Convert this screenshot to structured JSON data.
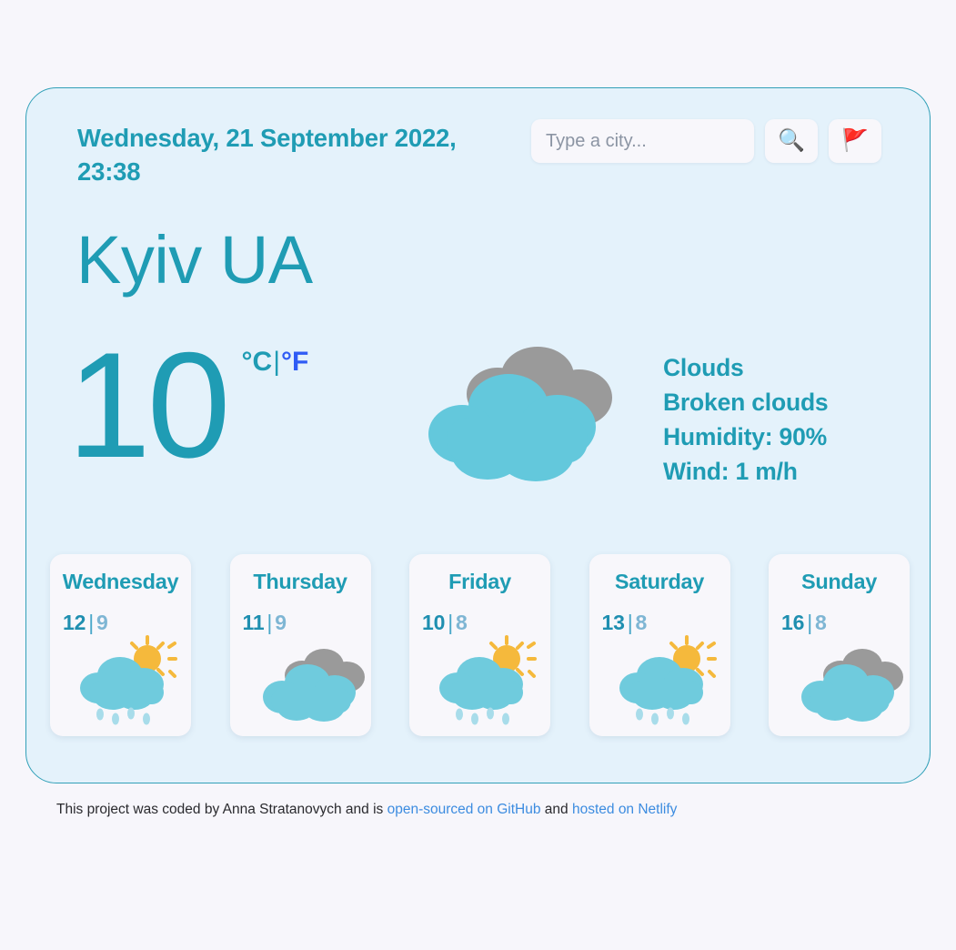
{
  "header": {
    "current_date": "Wednesday, 21 September 2022, 23:38",
    "search": {
      "placeholder": "Type a city...",
      "value": "",
      "search_button_icon": "magnifying-glass-icon",
      "search_button_glyph": "🔍",
      "location_button_icon": "flag-icon",
      "location_button_glyph": "🚩"
    }
  },
  "current": {
    "city": "Kyiv UA",
    "temperature": "10",
    "unit_celsius": "°C",
    "unit_separator": "|",
    "unit_fahrenheit": "°F",
    "active_unit": "°C",
    "icon": "broken-clouds-icon",
    "details": {
      "main": "Clouds",
      "description": "Broken clouds",
      "humidity": "Humidity: 90%",
      "wind": "Wind: 1 m/h"
    }
  },
  "forecast": [
    {
      "day": "Wednesday",
      "max": "12",
      "sep": "|",
      "min": "9",
      "icon": "sun-rain-cloud-icon"
    },
    {
      "day": "Thursday",
      "max": "11",
      "sep": "|",
      "min": "9",
      "icon": "broken-clouds-icon"
    },
    {
      "day": "Friday",
      "max": "10",
      "sep": "|",
      "min": "8",
      "icon": "sun-rain-cloud-icon"
    },
    {
      "day": "Saturday",
      "max": "13",
      "sep": "|",
      "min": "8",
      "icon": "sun-rain-cloud-icon"
    },
    {
      "day": "Sunday",
      "max": "16",
      "sep": "|",
      "min": "8",
      "icon": "broken-clouds-icon"
    }
  ],
  "footer": {
    "text_before": "This project was coded by Anna Stratanovych and is ",
    "link1": "open-sourced on GitHub",
    "text_middle": " and ",
    "link2": "hosted on Netlify"
  },
  "colors": {
    "page_background": "#f7f6fb",
    "card_background": "#e4f2fb",
    "card_border": "#31a0b8",
    "accent_teal": "#1f9cb4",
    "link_blue": "#3c8ce0",
    "fahrenheit_blue": "#2f5cf5",
    "cloud_blue": "#63c8dc",
    "cloud_gray": "#9a9a9a",
    "sun_yellow": "#f5b битва"
  }
}
